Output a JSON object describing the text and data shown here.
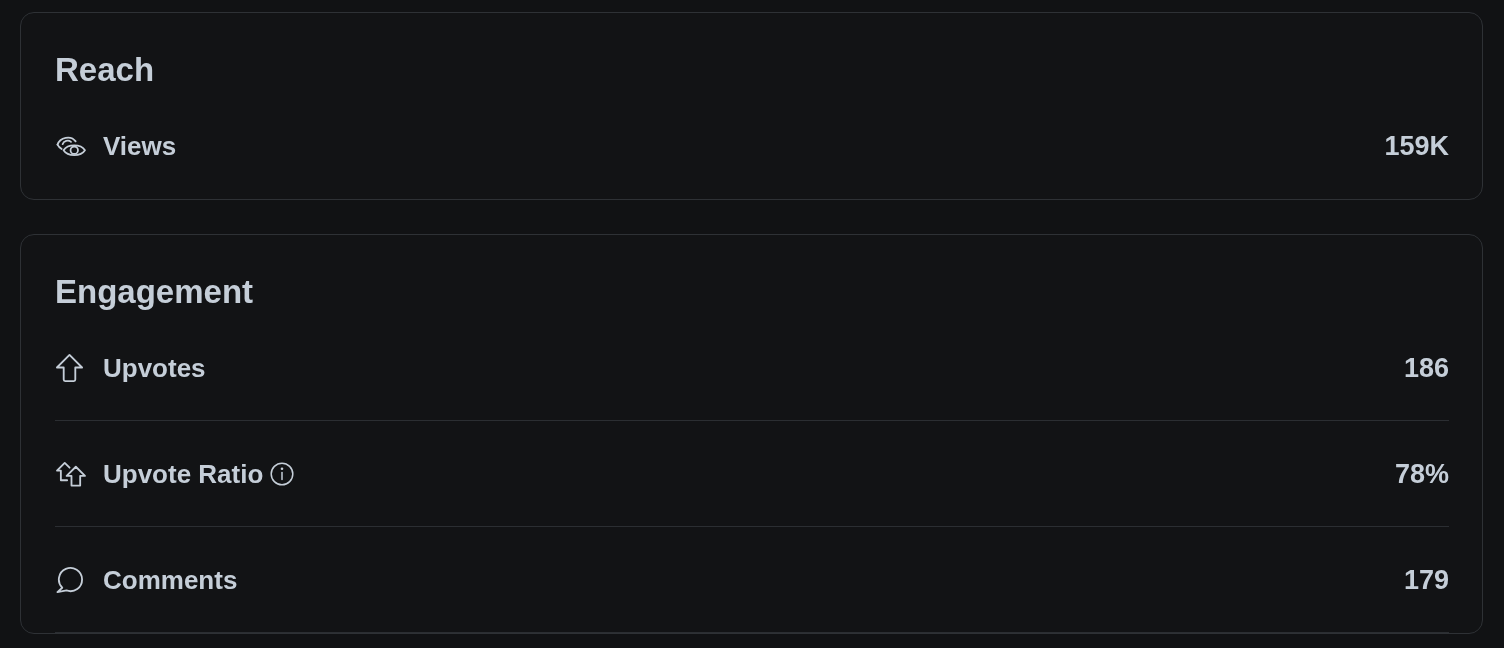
{
  "sections": [
    {
      "title": "Reach",
      "more_below": false,
      "metrics": [
        {
          "kind": "views",
          "label": "Views",
          "value": "159K",
          "info": false
        }
      ]
    },
    {
      "title": "Engagement",
      "more_below": true,
      "metrics": [
        {
          "kind": "upvotes",
          "label": "Upvotes",
          "value": "186",
          "info": false
        },
        {
          "kind": "ratio",
          "label": "Upvote Ratio",
          "value": "78%",
          "info": true
        },
        {
          "kind": "comments",
          "label": "Comments",
          "value": "179",
          "info": false
        }
      ]
    }
  ]
}
